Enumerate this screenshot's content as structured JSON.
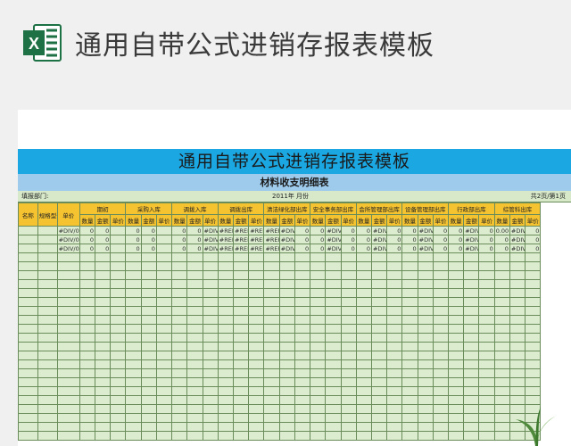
{
  "page_title": "通用自带公式进销存报表模板",
  "sheet": {
    "title": "通用自带公式进销存报表模板",
    "subtitle": "材料收支明细表",
    "dept_label": "填报部门:",
    "period": "2011年 月份",
    "page_info": "共2页/第1页"
  },
  "headers": {
    "name": "名称",
    "spec": "规格型号",
    "unit_price": "单价",
    "groups": [
      "期初",
      "采购入库",
      "调拨入库",
      "调拨出库",
      "清洁绿化部出库",
      "安全事务部出库",
      "会所管理部出库",
      "设备管理部出库",
      "行政部出库",
      "综管科出库"
    ],
    "qty": "数量",
    "amount": "金额",
    "unit_price_short": "单价"
  },
  "cells": {
    "div": "#DIV/0!",
    "ref": "#REF!",
    "zero": "0",
    "zero_dec": "0.00"
  },
  "colors": {
    "banner": "#1aa7e2",
    "subtitle": "#9ecbeb",
    "header": "#f5c330",
    "grid": "#dbeccf",
    "excel_green": "#1e7145"
  }
}
